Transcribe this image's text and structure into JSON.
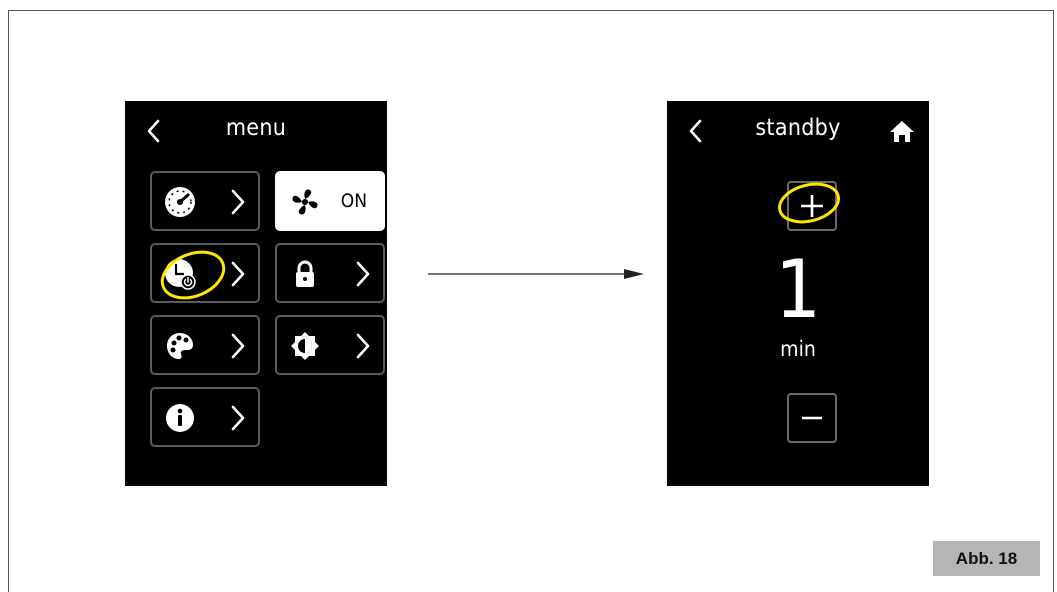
{
  "figure_label": "Abb. 18",
  "menu_screen": {
    "title": "menu",
    "tiles": [
      {
        "icon": "speedometer-icon"
      },
      {
        "icon": "fan-icon",
        "state": "ON"
      },
      {
        "icon": "standby-timer-icon"
      },
      {
        "icon": "lock-icon"
      },
      {
        "icon": "palette-icon"
      },
      {
        "icon": "brightness-icon"
      },
      {
        "icon": "info-icon"
      }
    ]
  },
  "standby_screen": {
    "title": "standby",
    "value": "1",
    "unit": "min"
  },
  "colors": {
    "screen_background": "#000000",
    "tile_border": "#5c5c5c",
    "highlight": "#ffe600",
    "badge": "#b5b5b5"
  }
}
